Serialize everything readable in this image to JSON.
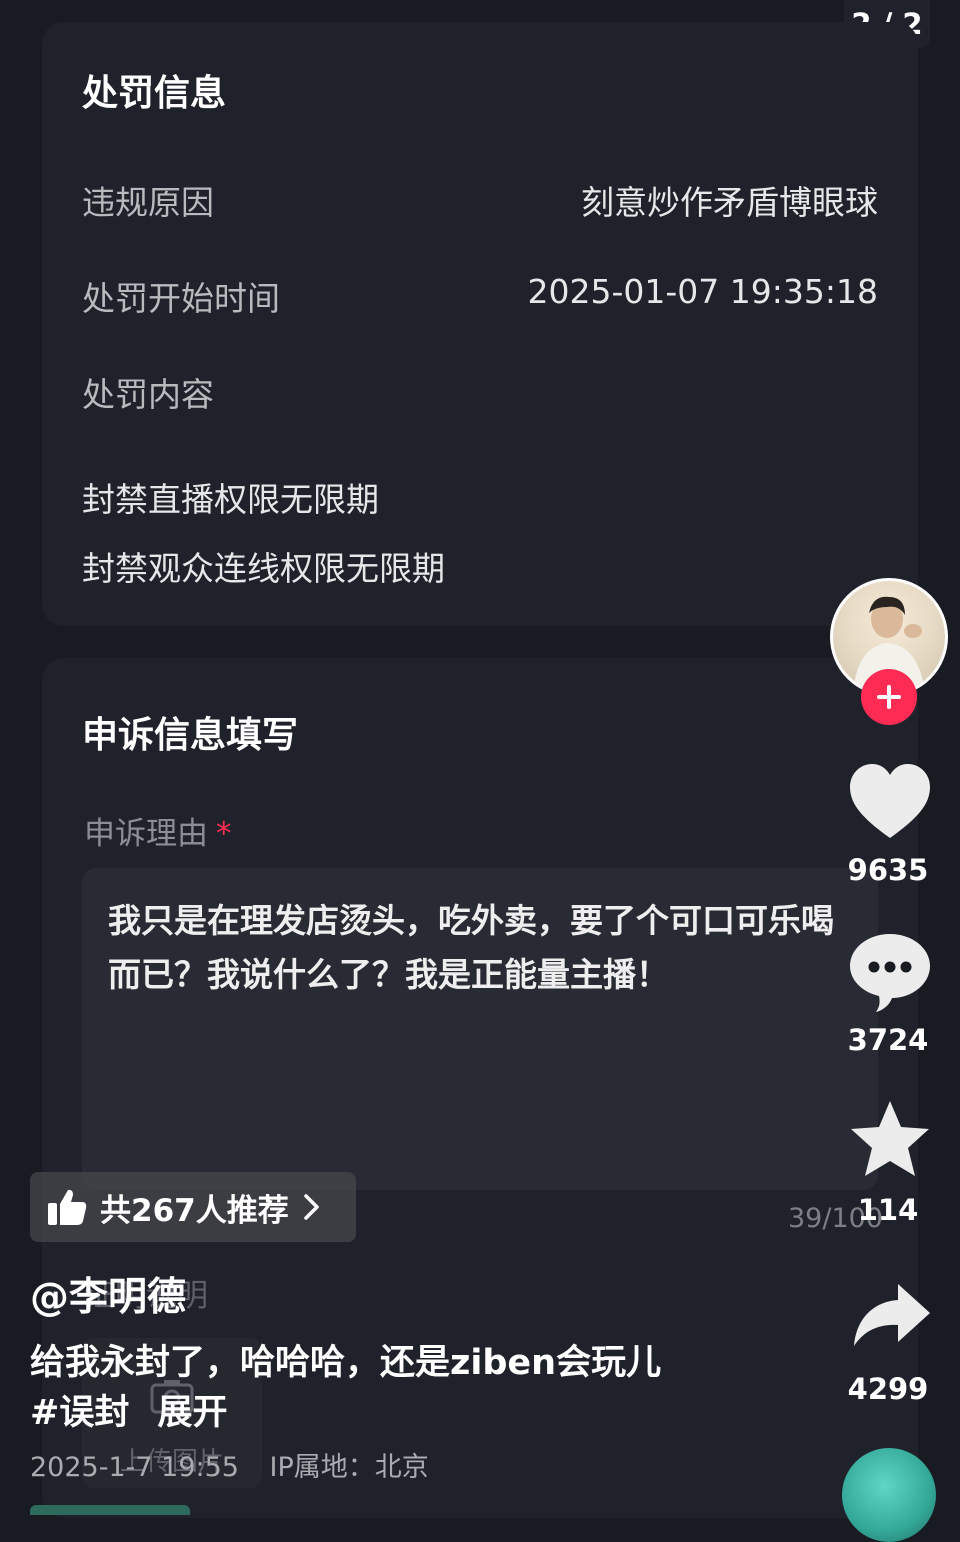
{
  "page_indicator": "2 / 2",
  "penalty": {
    "title": "处罚信息",
    "rows": [
      {
        "label": "违规原因",
        "value": "刻意炒作矛盾博眼球"
      },
      {
        "label": "处罚开始时间",
        "value": "2025-01-07 19:35:18"
      },
      {
        "label": "处罚内容",
        "value": ""
      }
    ],
    "contents": [
      "封禁直播权限无限期",
      "封禁观众连线权限无限期"
    ]
  },
  "appeal": {
    "title": "申诉信息填写",
    "reason_label": "申诉理由",
    "required_mark": "*",
    "reason_text": "我只是在理发店烫头，吃外卖，要了个可口可乐喝而已？我说什么了？我是正能量主播！",
    "char_count": "39/100",
    "upload_label": "证明说明",
    "upload_button": "上传图片"
  },
  "video": {
    "recommend_text": "共267人推荐",
    "author": "@李明德",
    "description": "给我永封了，哈哈哈，还是ziben会玩儿",
    "hashtag": "#误封",
    "expand": "展开",
    "date": "2025-1-7 19:55",
    "ip_location": "IP属地：北京"
  },
  "sidebar": {
    "likes": "9635",
    "comments": "3724",
    "favorites": "114",
    "shares": "4299"
  },
  "colors": {
    "accent": "#fe2c55",
    "card_bg": "#1f222a",
    "page_bg": "#181b22"
  }
}
